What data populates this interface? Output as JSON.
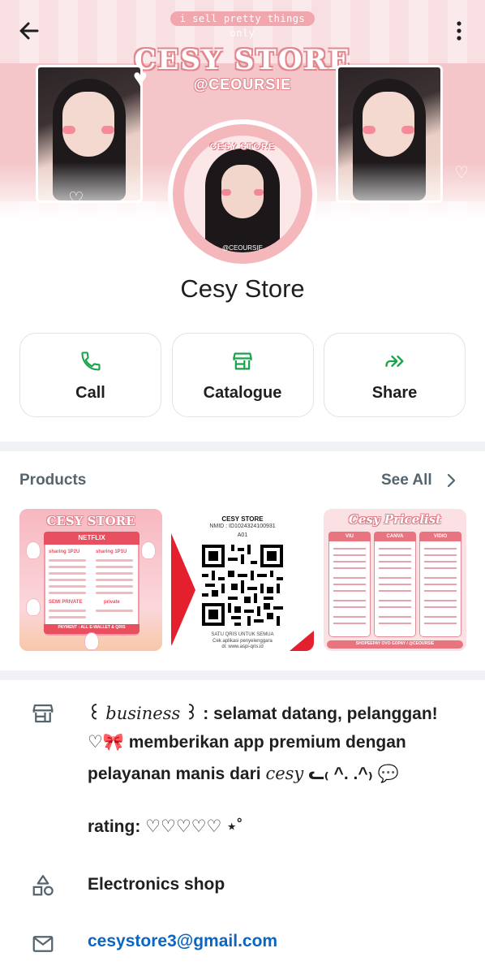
{
  "cover": {
    "tagline": "i sell pretty things only",
    "title": "CESY STORE",
    "handle": "@CEOURSIE",
    "badge": "CESY!"
  },
  "top_bar": {
    "back_icon": "arrow-left-icon",
    "more_icon": "more-vertical-icon"
  },
  "profile": {
    "name": "Cesy Store",
    "avatar_brand": "CESY STORE",
    "avatar_handle": "@CEOURSIE",
    "avatar_badge": "CESY!"
  },
  "actions": [
    {
      "label": "Call",
      "icon": "phone-icon"
    },
    {
      "label": "Catalogue",
      "icon": "storefront-icon"
    },
    {
      "label": "Share",
      "icon": "forward-icon"
    }
  ],
  "products": {
    "title": "Products",
    "see_all": "See All",
    "items": [
      {
        "title": "CESY STORE",
        "header": "NETFLIX",
        "sub_left": "sharing 1P2U",
        "sub_right": "sharing 1P1U",
        "section": "SEMI PRIVATE",
        "section_right": "private",
        "footer": "PAYMENT : ALL E-WALLET & QRIS"
      },
      {
        "title": "CESY STORE",
        "nmid": "NMID : ID1024324100931",
        "code": "A01",
        "caption": "SATU QRIS UNTUK SEMUA",
        "check": "Cek aplikasi penyelenggara",
        "check_url": "di: www.aspi-qris.id"
      },
      {
        "title": "Cesy Pricelist",
        "columns": [
          "VIU",
          "CANVA",
          "VIDIO"
        ],
        "footer": "SHOPEEPAY OVO GOPAY / @CEOURSIE"
      }
    ]
  },
  "info": {
    "description_prefix": "꒰ ",
    "description_italic": "business",
    "description_rest_1": " ꒱ : selamat datang, pelanggan!",
    "description_line_2": "♡🎀 memberikan app premium dengan",
    "description_line_3_a": "pelayanan manis dari ",
    "description_line_3_b": "cesy",
    "description_line_3_c": " ᓚ₍ ^. .^₎ 💬",
    "rating_line": "rating: ♡♡♡♡♡ ⋆˚",
    "category": "Electronics shop",
    "email": "cesystore3@gmail.com",
    "icons": [
      "storefront-icon",
      "shapes-icon",
      "mail-icon"
    ]
  },
  "colors": {
    "accent_green": "#1aa34a",
    "link_blue": "#0b65c2",
    "secondary_text": "#54656f",
    "cover_pink": "#f4c6c9"
  }
}
